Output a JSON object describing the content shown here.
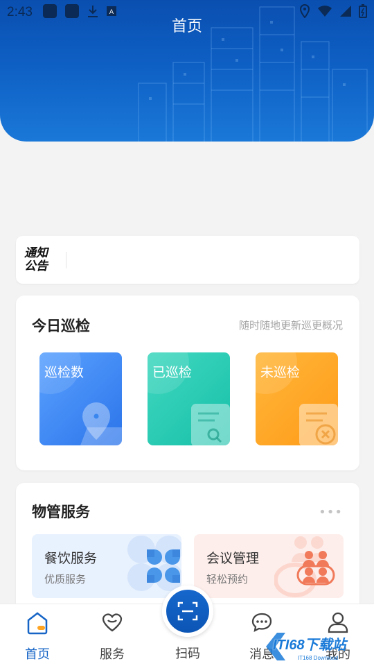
{
  "status_bar": {
    "time": "2:43"
  },
  "header": {
    "title": "首页"
  },
  "notice": {
    "logo_line1": "通知",
    "logo_line2": "公告"
  },
  "patrol": {
    "title": "今日巡检",
    "subtitle": "随时随地更新巡更概况",
    "tiles": [
      {
        "label": "巡检数",
        "color": "#3f8cf5"
      },
      {
        "label": "已巡检",
        "color": "#24c8b0"
      },
      {
        "label": "未巡检",
        "color": "#ffa423"
      }
    ]
  },
  "services": {
    "title": "物管服务",
    "more": "•••",
    "items": [
      {
        "name": "餐饮服务",
        "desc": "优质服务"
      },
      {
        "name": "会议管理",
        "desc": "轻松预约"
      }
    ]
  },
  "nav": {
    "items": [
      {
        "label": "首页"
      },
      {
        "label": "服务"
      },
      {
        "label": "扫码"
      },
      {
        "label": "消息"
      },
      {
        "label": "我的"
      }
    ]
  },
  "watermark": {
    "text": "ITI68下载站",
    "sub": "IT168 Download"
  },
  "colors": {
    "brand": "#0e5fc4",
    "active": "#1564c6"
  }
}
